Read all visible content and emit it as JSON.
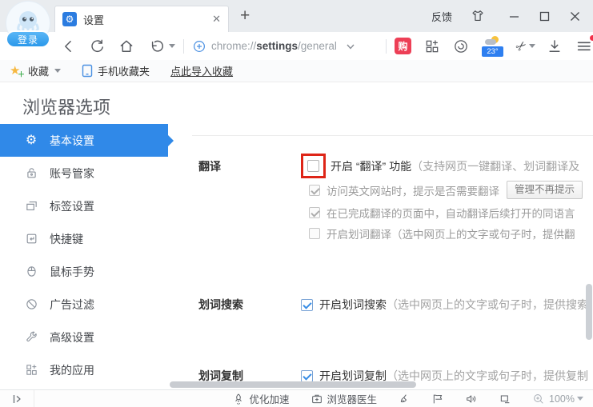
{
  "titlebar": {
    "feedback": "反馈",
    "tab_title": "设置",
    "tab_close": "✕",
    "new_tab": "+",
    "login": "登录",
    "favicon_glyph": "⚙"
  },
  "toolbar": {
    "url_scheme": "chrome://",
    "url_host": "settings",
    "url_path": "/general",
    "shop_badge": "购",
    "weather_temp": "23°",
    "scissors_glyph": "✂"
  },
  "bookmarks_bar": {
    "favorites": "收藏",
    "favorites_star": "★",
    "favorites_plus": "＋",
    "mobile_folder": "手机收藏夹",
    "import_link": "点此导入收藏"
  },
  "page": {
    "title": "浏览器选项"
  },
  "sidebar": {
    "items": [
      {
        "label": "基本设置",
        "icon": "gear",
        "active": true
      },
      {
        "label": "账号管家",
        "icon": "lock",
        "active": false
      },
      {
        "label": "标签设置",
        "icon": "tabs",
        "active": false
      },
      {
        "label": "快捷键",
        "icon": "hotkey",
        "active": false
      },
      {
        "label": "鼠标手势",
        "icon": "mouse",
        "active": false
      },
      {
        "label": "广告过滤",
        "icon": "ad-block",
        "active": false
      },
      {
        "label": "高级设置",
        "icon": "wrench",
        "active": false
      },
      {
        "label": "我的应用",
        "icon": "apps",
        "active": false
      }
    ],
    "gear_glyph": "⚙"
  },
  "settings": {
    "translate": {
      "label": "翻译",
      "main": {
        "checked": false,
        "highlighted": true,
        "text": "开启 “翻译” 功能",
        "hint": "（支持网页一键翻译、划词翻译及"
      },
      "sub1": {
        "checked": true,
        "text": "访问英文网站时，提示是否需要翻译",
        "button": "管理不再提示"
      },
      "sub2": {
        "checked": true,
        "text": "在已完成翻译的页面中，自动翻译后续打开的同语言"
      },
      "sub3": {
        "checked": false,
        "text": "开启划词翻译（选中网页上的文字或句子时，提供翻"
      }
    },
    "word_search": {
      "label": "划词搜索",
      "main": {
        "checked": true,
        "text": "开启划词搜索",
        "hint": "（选中网页上的文字或句子时，提供搜索"
      }
    },
    "word_copy": {
      "label": "划词复制",
      "main": {
        "checked": true,
        "text": "开启划词复制",
        "hint": "（选中网页上的文字或句子时，提供复制"
      }
    }
  },
  "statusbar": {
    "speed_boost": "优化加速",
    "browser_doctor": "浏览器医生",
    "zoom_level": "100%"
  },
  "colors": {
    "accent_blue": "#3089e8",
    "highlight_red": "#de2517",
    "shop_red": "#ed3f56",
    "weather_blue": "#2e7ff0"
  }
}
